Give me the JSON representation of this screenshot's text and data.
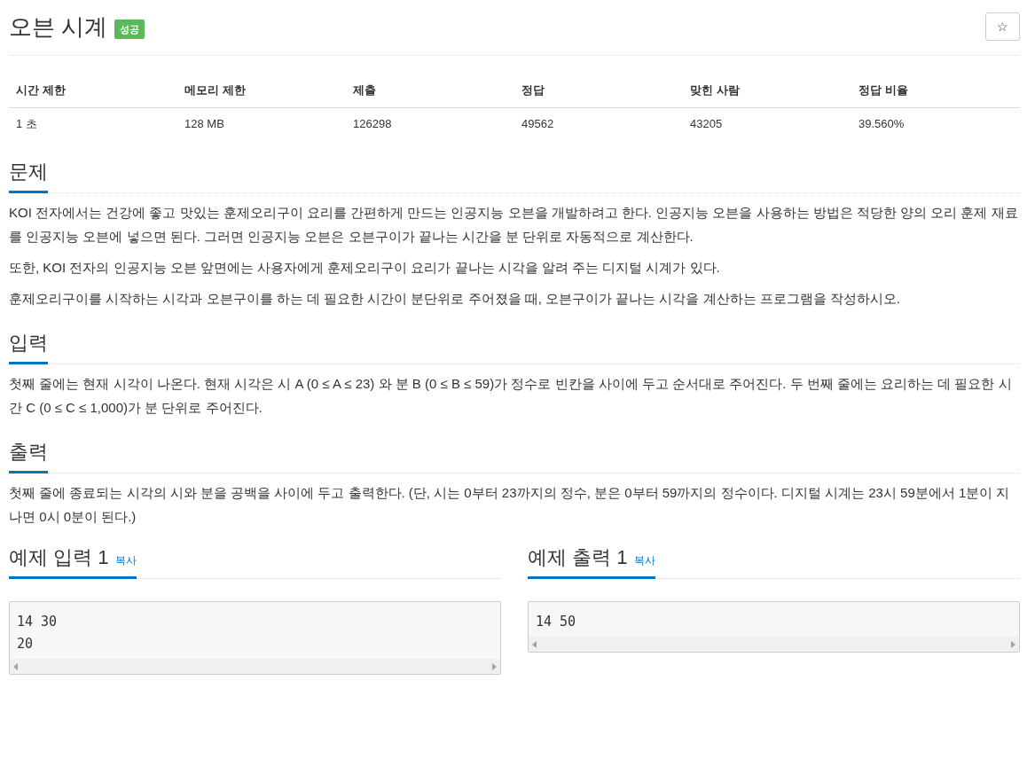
{
  "title": "오븐 시계",
  "status_badge": "성공",
  "favorite_button": "☆",
  "info_table": {
    "columns": [
      "시간 제한",
      "메모리 제한",
      "제출",
      "정답",
      "맞힌 사람",
      "정답 비율"
    ],
    "rows": [
      [
        "1 초",
        "128 MB",
        "126298",
        "49562",
        "43205",
        "39.560%"
      ]
    ]
  },
  "sections": [
    {
      "heading": "문제",
      "paragraphs": [
        "KOI 전자에서는 건강에 좋고 맛있는 훈제오리구이 요리를 간편하게 만드는 인공지능 오븐을 개발하려고 한다. 인공지능 오븐을 사용하는 방법은 적당한 양의 오리 훈제 재료를 인공지능 오븐에 넣으면 된다. 그러면 인공지능 오븐은 오븐구이가 끝나는 시간을 분 단위로 자동적으로 계산한다.",
        "또한, KOI 전자의 인공지능 오븐 앞면에는 사용자에게 훈제오리구이 요리가 끝나는 시각을 알려 주는 디지털 시계가 있다.",
        "훈제오리구이를 시작하는 시각과 오븐구이를 하는 데 필요한 시간이 분단위로 주어졌을 때, 오븐구이가 끝나는 시각을 계산하는 프로그램을 작성하시오."
      ]
    },
    {
      "heading": "입력",
      "paragraphs": [
        "첫째 줄에는 현재 시각이 나온다. 현재 시각은 시 A (0 ≤ A ≤ 23) 와 분 B (0 ≤ B ≤ 59)가 정수로 빈칸을 사이에 두고 순서대로 주어진다. 두 번째 줄에는 요리하는 데 필요한 시간 C (0 ≤ C ≤ 1,000)가 분 단위로 주어진다."
      ]
    },
    {
      "heading": "출력",
      "paragraphs": [
        "첫째 줄에 종료되는 시각의 시와 분을 공백을 사이에 두고 출력한다. (단, 시는 0부터 23까지의 정수, 분은 0부터 59까지의 정수이다. 디지털 시계는 23시 59분에서 1분이 지나면 0시 0분이 된다.)"
      ]
    }
  ],
  "samples": [
    {
      "heading": "예제 입력 1",
      "copy_link": "복사",
      "lines": [
        "14 30",
        "20"
      ]
    },
    {
      "heading": "예제 출력 1",
      "copy_link": "복사",
      "lines": [
        "14 50"
      ]
    }
  ]
}
